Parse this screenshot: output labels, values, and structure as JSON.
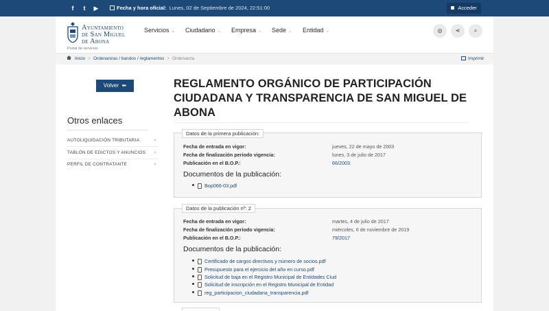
{
  "topbar": {
    "social_facebook": "f",
    "social_twitter": "t",
    "social_youtube": "▶",
    "datetime_label": "Fecha y hora oficial:",
    "datetime_value": "Lunes, 02 de Septiembre de 2024, 22:51:00",
    "login_label": "Acceder"
  },
  "header": {
    "logo_line1": "Ayuntamiento",
    "logo_line2": "de San Miguel",
    "logo_line3": "de Abona",
    "portal": "Portal de servicios",
    "nav": [
      "Servicios",
      "Ciudadano",
      "Empresa",
      "Sede",
      "Entidad"
    ]
  },
  "breadcrumb": {
    "items": [
      "Inicio",
      "Ordenanzas / bandos / reglamentos",
      "Ordenanza"
    ],
    "print_label": "Imprimir"
  },
  "sidebar": {
    "back_label": "Volver",
    "heading": "Otros enlaces",
    "links": [
      "AUTOLIQUIDACIÓN TRIBUTARIA",
      "TABLÓN DE EDICTOS Y ANUNCIOS",
      "PERFIL DE CONTRATANTE"
    ]
  },
  "main": {
    "title": "REGLAMENTO ORGÁNICO DE PARTICIPACIÓN CIUDADANA Y TRANSPARENCIA DE SAN MIGUEL DE ABONA",
    "pub1": {
      "legend": "Datos de la primera publicación:",
      "rows": [
        {
          "label": "Fecha de entrada en vigor:",
          "value": "jueves, 22 de mayo de 2003"
        },
        {
          "label": "Fecha de finalización periodo vigencia:",
          "value": "lunes, 3 de julio de 2017"
        },
        {
          "label": "Publicación en el B.O.P.:",
          "value": "66/2003"
        }
      ],
      "docs_heading": "Documentos de la publicación:",
      "docs": [
        "Bop066-03.pdf"
      ]
    },
    "pub2": {
      "legend": "Datos de la publicación nº: 2",
      "rows": [
        {
          "label": "Fecha de entrada en vigor:",
          "value": "martes, 4 de julio de 2017"
        },
        {
          "label": "Fecha de finalización periodo vigencia:",
          "value": "miércoles, 6 de noviembre de 2019"
        },
        {
          "label": "Publicación en el B.O.P.:",
          "value": "79/2017"
        }
      ],
      "docs_heading": "Documentos de la publicación:",
      "docs": [
        "Certificado de cargos directivos y número de socios.pdf",
        "Presupuesto para el ejercicio del año en curso.pdf",
        "Solicitud de baja en el Registro Municipal de Entidades Ciud",
        "Solicitud de inscripción en el Registro Municipal de Entidad",
        "reg_participacion_ciudadana_transparencia.pdf"
      ]
    }
  }
}
